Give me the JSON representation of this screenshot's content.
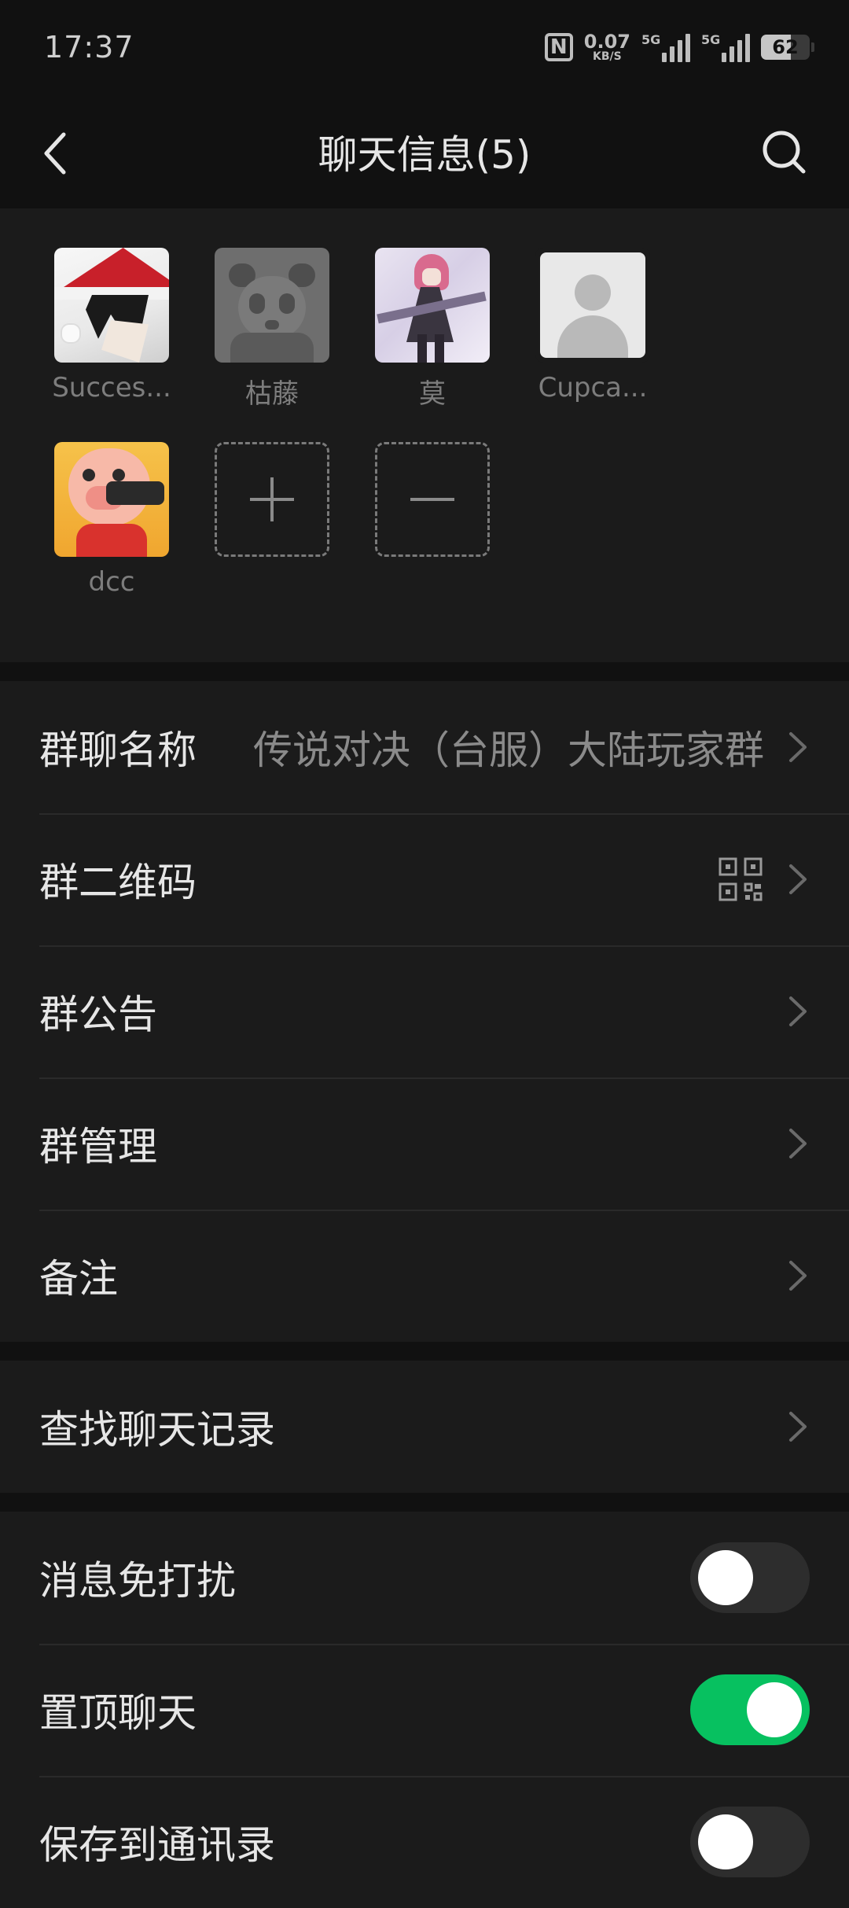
{
  "status": {
    "time": "17:37",
    "speed_value": "0.07",
    "speed_unit": "KB/S",
    "sim1_tag": "5G",
    "sim2_tag": "5G",
    "battery": "62",
    "battery_level_percent": 62
  },
  "header": {
    "title": "聊天信息(5)",
    "back_icon": "chevron-left-icon",
    "search_icon": "search-icon"
  },
  "members": [
    {
      "name": "Succes...",
      "avatar": "santa-hat-anime-avatar"
    },
    {
      "name": "枯藤",
      "avatar": "panda-avatar"
    },
    {
      "name": "莫",
      "avatar": "pink-hair-anime-avatar"
    },
    {
      "name": "Cupca...",
      "avatar": "default-person-avatar"
    },
    {
      "name": "dcc",
      "avatar": "cartoon-pig-avatar"
    }
  ],
  "member_actions": {
    "add_symbol": "+",
    "remove_symbol": "—"
  },
  "settings": {
    "group_name_label": "群聊名称",
    "group_name_value": "传说对决（台服）大陆玩家群",
    "qr_label": "群二维码",
    "announcement_label": "群公告",
    "manage_label": "群管理",
    "remark_label": "备注",
    "search_history_label": "查找聊天记录",
    "mute_label": "消息免打扰",
    "mute_on": false,
    "pin_label": "置顶聊天",
    "pin_on": true,
    "save_contacts_label": "保存到通讯录",
    "save_contacts_on": false
  },
  "colors": {
    "background": "#111111",
    "panel": "#1b1b1b",
    "accent_green": "#07c160"
  }
}
